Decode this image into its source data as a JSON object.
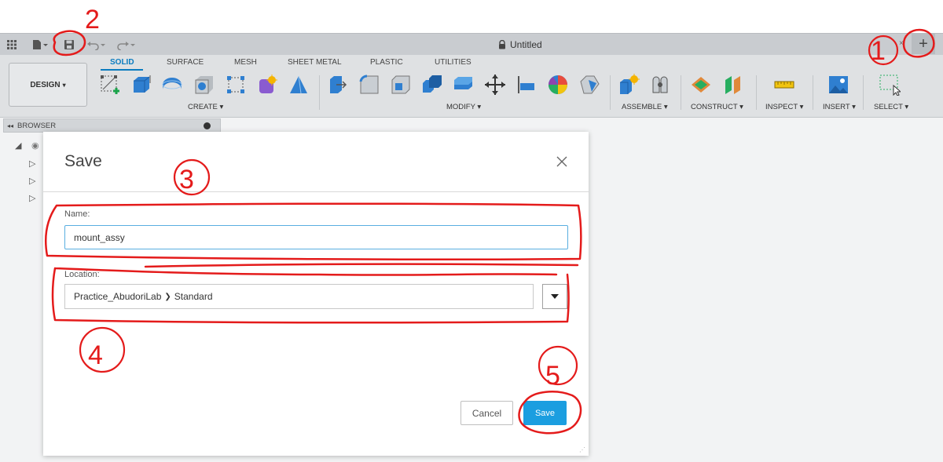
{
  "app": {
    "document_title": "Untitled",
    "new_tab_symbol": "+",
    "tab_close_symbol": "×"
  },
  "quick_access": {
    "icons": [
      "apps-grid-icon",
      "file-icon",
      "save-icon",
      "undo-icon",
      "redo-icon"
    ]
  },
  "workspace": {
    "label": "DESIGN",
    "caret": "▾"
  },
  "ribbon": {
    "tabs": [
      {
        "label": "SOLID",
        "active": true
      },
      {
        "label": "SURFACE",
        "active": false
      },
      {
        "label": "MESH",
        "active": false
      },
      {
        "label": "SHEET METAL",
        "active": false
      },
      {
        "label": "PLASTIC",
        "active": false
      },
      {
        "label": "UTILITIES",
        "active": false
      }
    ],
    "groups": [
      {
        "label": "CREATE ▾"
      },
      {
        "label": "MODIFY ▾"
      },
      {
        "label": "ASSEMBLE ▾"
      },
      {
        "label": "CONSTRUCT ▾"
      },
      {
        "label": "INSPECT ▾"
      },
      {
        "label": "INSERT ▾"
      },
      {
        "label": "SELECT ▾"
      }
    ]
  },
  "browser": {
    "title": "BROWSER",
    "collapse_symbol": "◂◂"
  },
  "dialog": {
    "title": "Save",
    "name_label": "Name:",
    "name_value": "mount_assy",
    "location_label": "Location:",
    "location_project": "Practice_AbudoriLab",
    "location_separator": "❯",
    "location_folder": "Standard",
    "cancel_label": "Cancel",
    "save_label": "Save"
  },
  "annotations": {
    "color": "#e41b1b",
    "labels": [
      "1",
      "2",
      "3",
      "4",
      "5"
    ]
  },
  "colors": {
    "accent": "#0a7bbf",
    "save_button": "#1b9ee0",
    "input_focus": "#59aee0"
  }
}
